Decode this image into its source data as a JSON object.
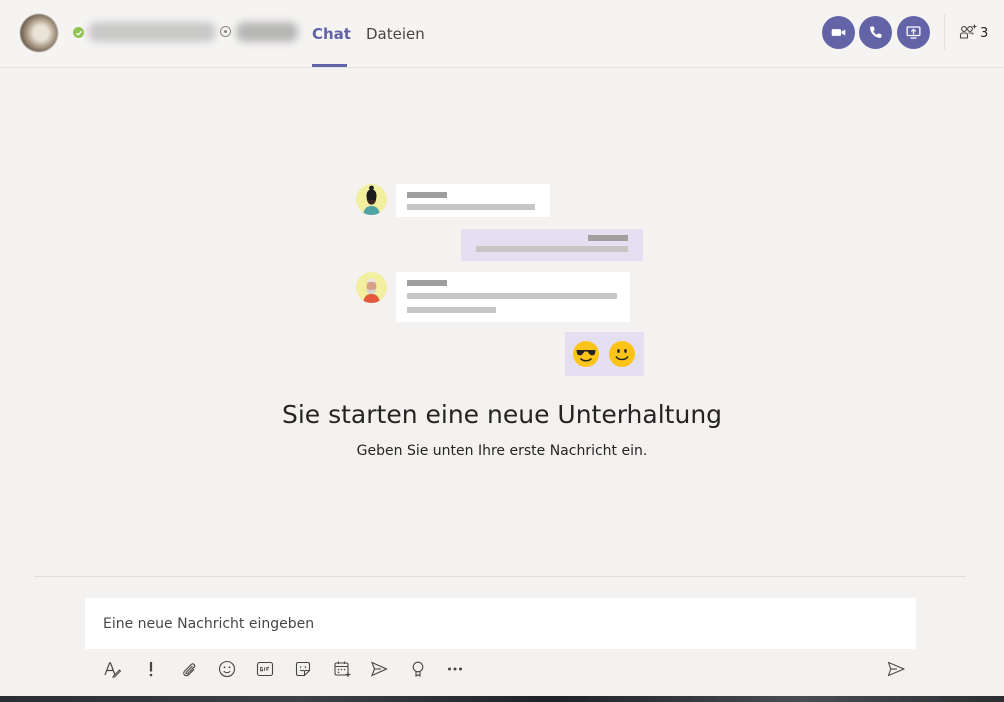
{
  "header": {
    "tabs": [
      {
        "label": "Chat",
        "active": true
      },
      {
        "label": "Dateien",
        "active": false
      }
    ],
    "participants_count": "3",
    "icons": {
      "video": "video-call-icon",
      "audio": "audio-call-icon",
      "share": "share-screen-icon",
      "people": "add-people-icon"
    },
    "accent_color": "#6264a7",
    "presence_color": "#92c353"
  },
  "empty_state": {
    "title": "Sie starten eine neue Unterhaltung",
    "subtitle": "Geben Sie unten Ihre erste Nachricht ein."
  },
  "compose": {
    "placeholder": "Eine neue Nachricht eingeben"
  },
  "toolbar": [
    "format-icon",
    "important-icon",
    "attach-icon",
    "emoji-icon",
    "gif-icon",
    "sticker-icon",
    "meeting-icon",
    "stream-icon",
    "praise-icon",
    "more-icon",
    "send-icon"
  ]
}
